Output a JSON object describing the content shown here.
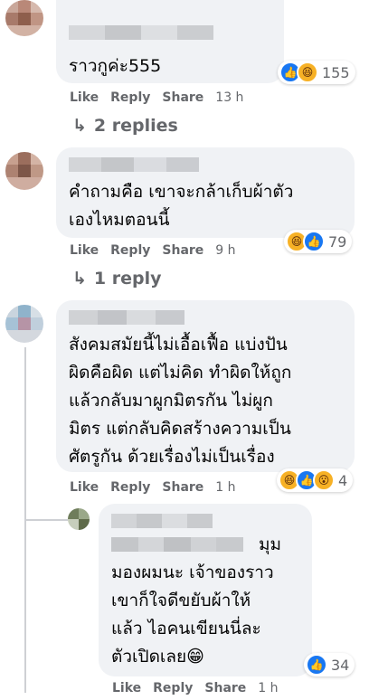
{
  "comments": [
    {
      "text": "ราวกูค่ะ555",
      "actions": {
        "like": "Like",
        "reply": "Reply",
        "share": "Share",
        "time": "13 h"
      },
      "reaction_count": "155",
      "reactions": [
        "like-icon",
        "haha-icon"
      ],
      "replies_label": "2 replies"
    },
    {
      "text": "คำถามคือ เขาจะกล้าเก็บผ้าตัว\nเองไหมตอนนี้",
      "actions": {
        "like": "Like",
        "reply": "Reply",
        "share": "Share",
        "time": "9 h"
      },
      "reaction_count": "79",
      "reactions": [
        "haha-icon",
        "like-icon"
      ],
      "replies_label": "1 reply"
    },
    {
      "text": "สังคมสมัยนี้ไม่เอื้อเฟื้อ แบ่งปัน\nผิดคือผิด แต่ไม่คิด ทำผิดให้ถูก\nแล้วกลับมาผูกมิตรกัน ไม่ผูก\nมิตร แต่กลับคิดสร้างความเป็น\nศัตรูกัน ด้วยเรื่องไม่เป็นเรื่อง",
      "actions": {
        "like": "Like",
        "reply": "Reply",
        "share": "Share",
        "time": "1 h"
      },
      "reaction_count": "4",
      "reactions": [
        "haha-icon",
        "like-icon",
        "wow-icon"
      ]
    },
    {
      "text_first": "มุม",
      "text": "มองผมนะ เจ้าของราว\nเขาก็ใจดีขยับผ้าให้\nแล้ว ไอคนเขียนนี่ละ\nตัวเปิดเลย😁",
      "actions": {
        "like": "Like",
        "reply": "Reply",
        "share": "Share",
        "time": "1 h"
      },
      "reaction_count": "34",
      "reactions": [
        "like-icon"
      ]
    }
  ],
  "colors": {
    "bubble": "#f0f2f5",
    "meta": "#65676b",
    "like": "#1877f2",
    "haha": "#f7b125"
  }
}
